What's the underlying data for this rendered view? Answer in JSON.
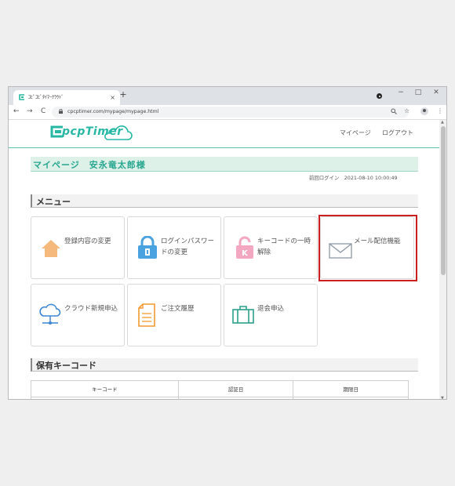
{
  "browser": {
    "tab_title": "ｺﾋﾟｺﾋﾟﾀｲﾏｰｸﾗｳﾄﾞ",
    "tab_close": "×",
    "new_tab": "+",
    "url": "cpcptimer.com/mypage/mypage.html",
    "window_minimize": "−",
    "window_maximize": "□",
    "window_close": "✕",
    "nav_back": "←",
    "nav_forward": "→",
    "nav_reload": "C",
    "icon_zoom": "🔍",
    "icon_star": "☆",
    "icon_menu": "⋮"
  },
  "header": {
    "logo_text": "pcpTimer",
    "links": [
      "マイページ",
      "ログアウト"
    ]
  },
  "mypage": {
    "title": "マイページ　安永竜太郎様",
    "last_login": "前回ログイン　2021-08-10 10:00:49"
  },
  "menu": {
    "heading": "メニュー",
    "items": [
      {
        "label": "登録内容の変更",
        "icon": "home-icon",
        "color": "#f5b97e"
      },
      {
        "label": "ログインパスワードの変更",
        "icon": "lock-icon",
        "color": "#4aa3e0"
      },
      {
        "label": "キーコードの一時解除",
        "icon": "key-unlock-icon",
        "color": "#f3a7c0"
      },
      {
        "label": "メール配信機能",
        "icon": "mail-icon",
        "color": "#8d97a5"
      },
      {
        "label": "クラウド新規申込",
        "icon": "cloud-icon",
        "color": "#3a86d4"
      },
      {
        "label": "ご注文履歴",
        "icon": "document-icon",
        "color": "#f19a2e"
      },
      {
        "label": "退会申込",
        "icon": "briefcase-icon",
        "color": "#2aa08a"
      }
    ]
  },
  "keycodes": {
    "heading": "保有キーコード",
    "columns": [
      "キーコード",
      "認証日",
      "期限日"
    ]
  }
}
